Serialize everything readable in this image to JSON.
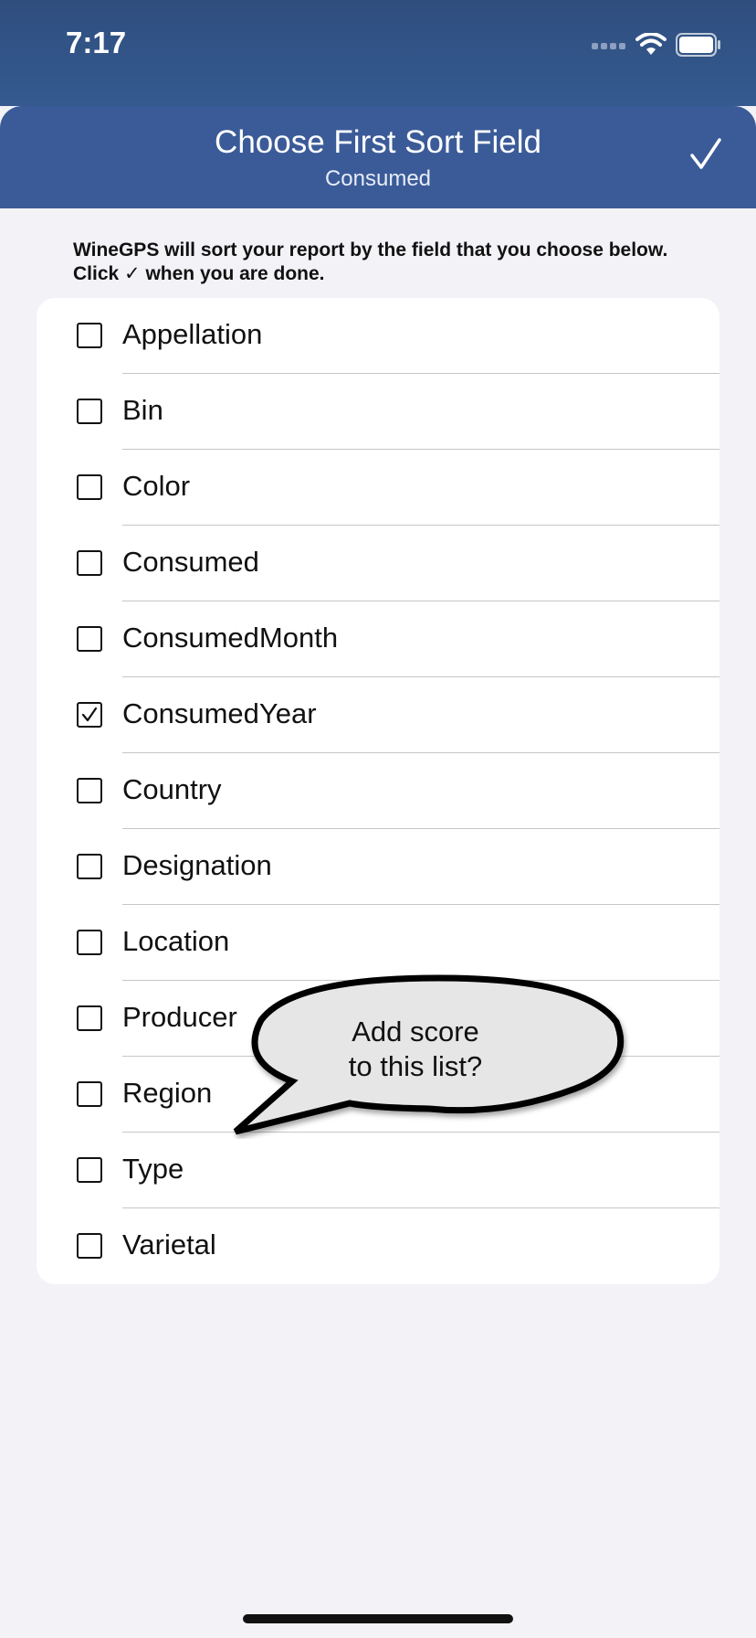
{
  "status_bar": {
    "time": "7:17"
  },
  "header": {
    "title": "Choose First Sort Field",
    "subtitle": "Consumed"
  },
  "instructions": "WineGPS will sort your report by the field that you choose below. Click ✓ when you are done.",
  "items": [
    {
      "label": "Appellation",
      "checked": false
    },
    {
      "label": "Bin",
      "checked": false
    },
    {
      "label": "Color",
      "checked": false
    },
    {
      "label": "Consumed",
      "checked": false
    },
    {
      "label": "ConsumedMonth",
      "checked": false
    },
    {
      "label": "ConsumedYear",
      "checked": true
    },
    {
      "label": "Country",
      "checked": false
    },
    {
      "label": "Designation",
      "checked": false
    },
    {
      "label": "Location",
      "checked": false
    },
    {
      "label": "Producer",
      "checked": false
    },
    {
      "label": "Region",
      "checked": false
    },
    {
      "label": "Type",
      "checked": false
    },
    {
      "label": "Varietal",
      "checked": false
    }
  ],
  "callout": {
    "text": "Add score\nto this list?"
  },
  "colors": {
    "header_bg": "#3b5b98",
    "status_bg": "#2f4e7e",
    "page_bg": "#f2f2f7"
  }
}
